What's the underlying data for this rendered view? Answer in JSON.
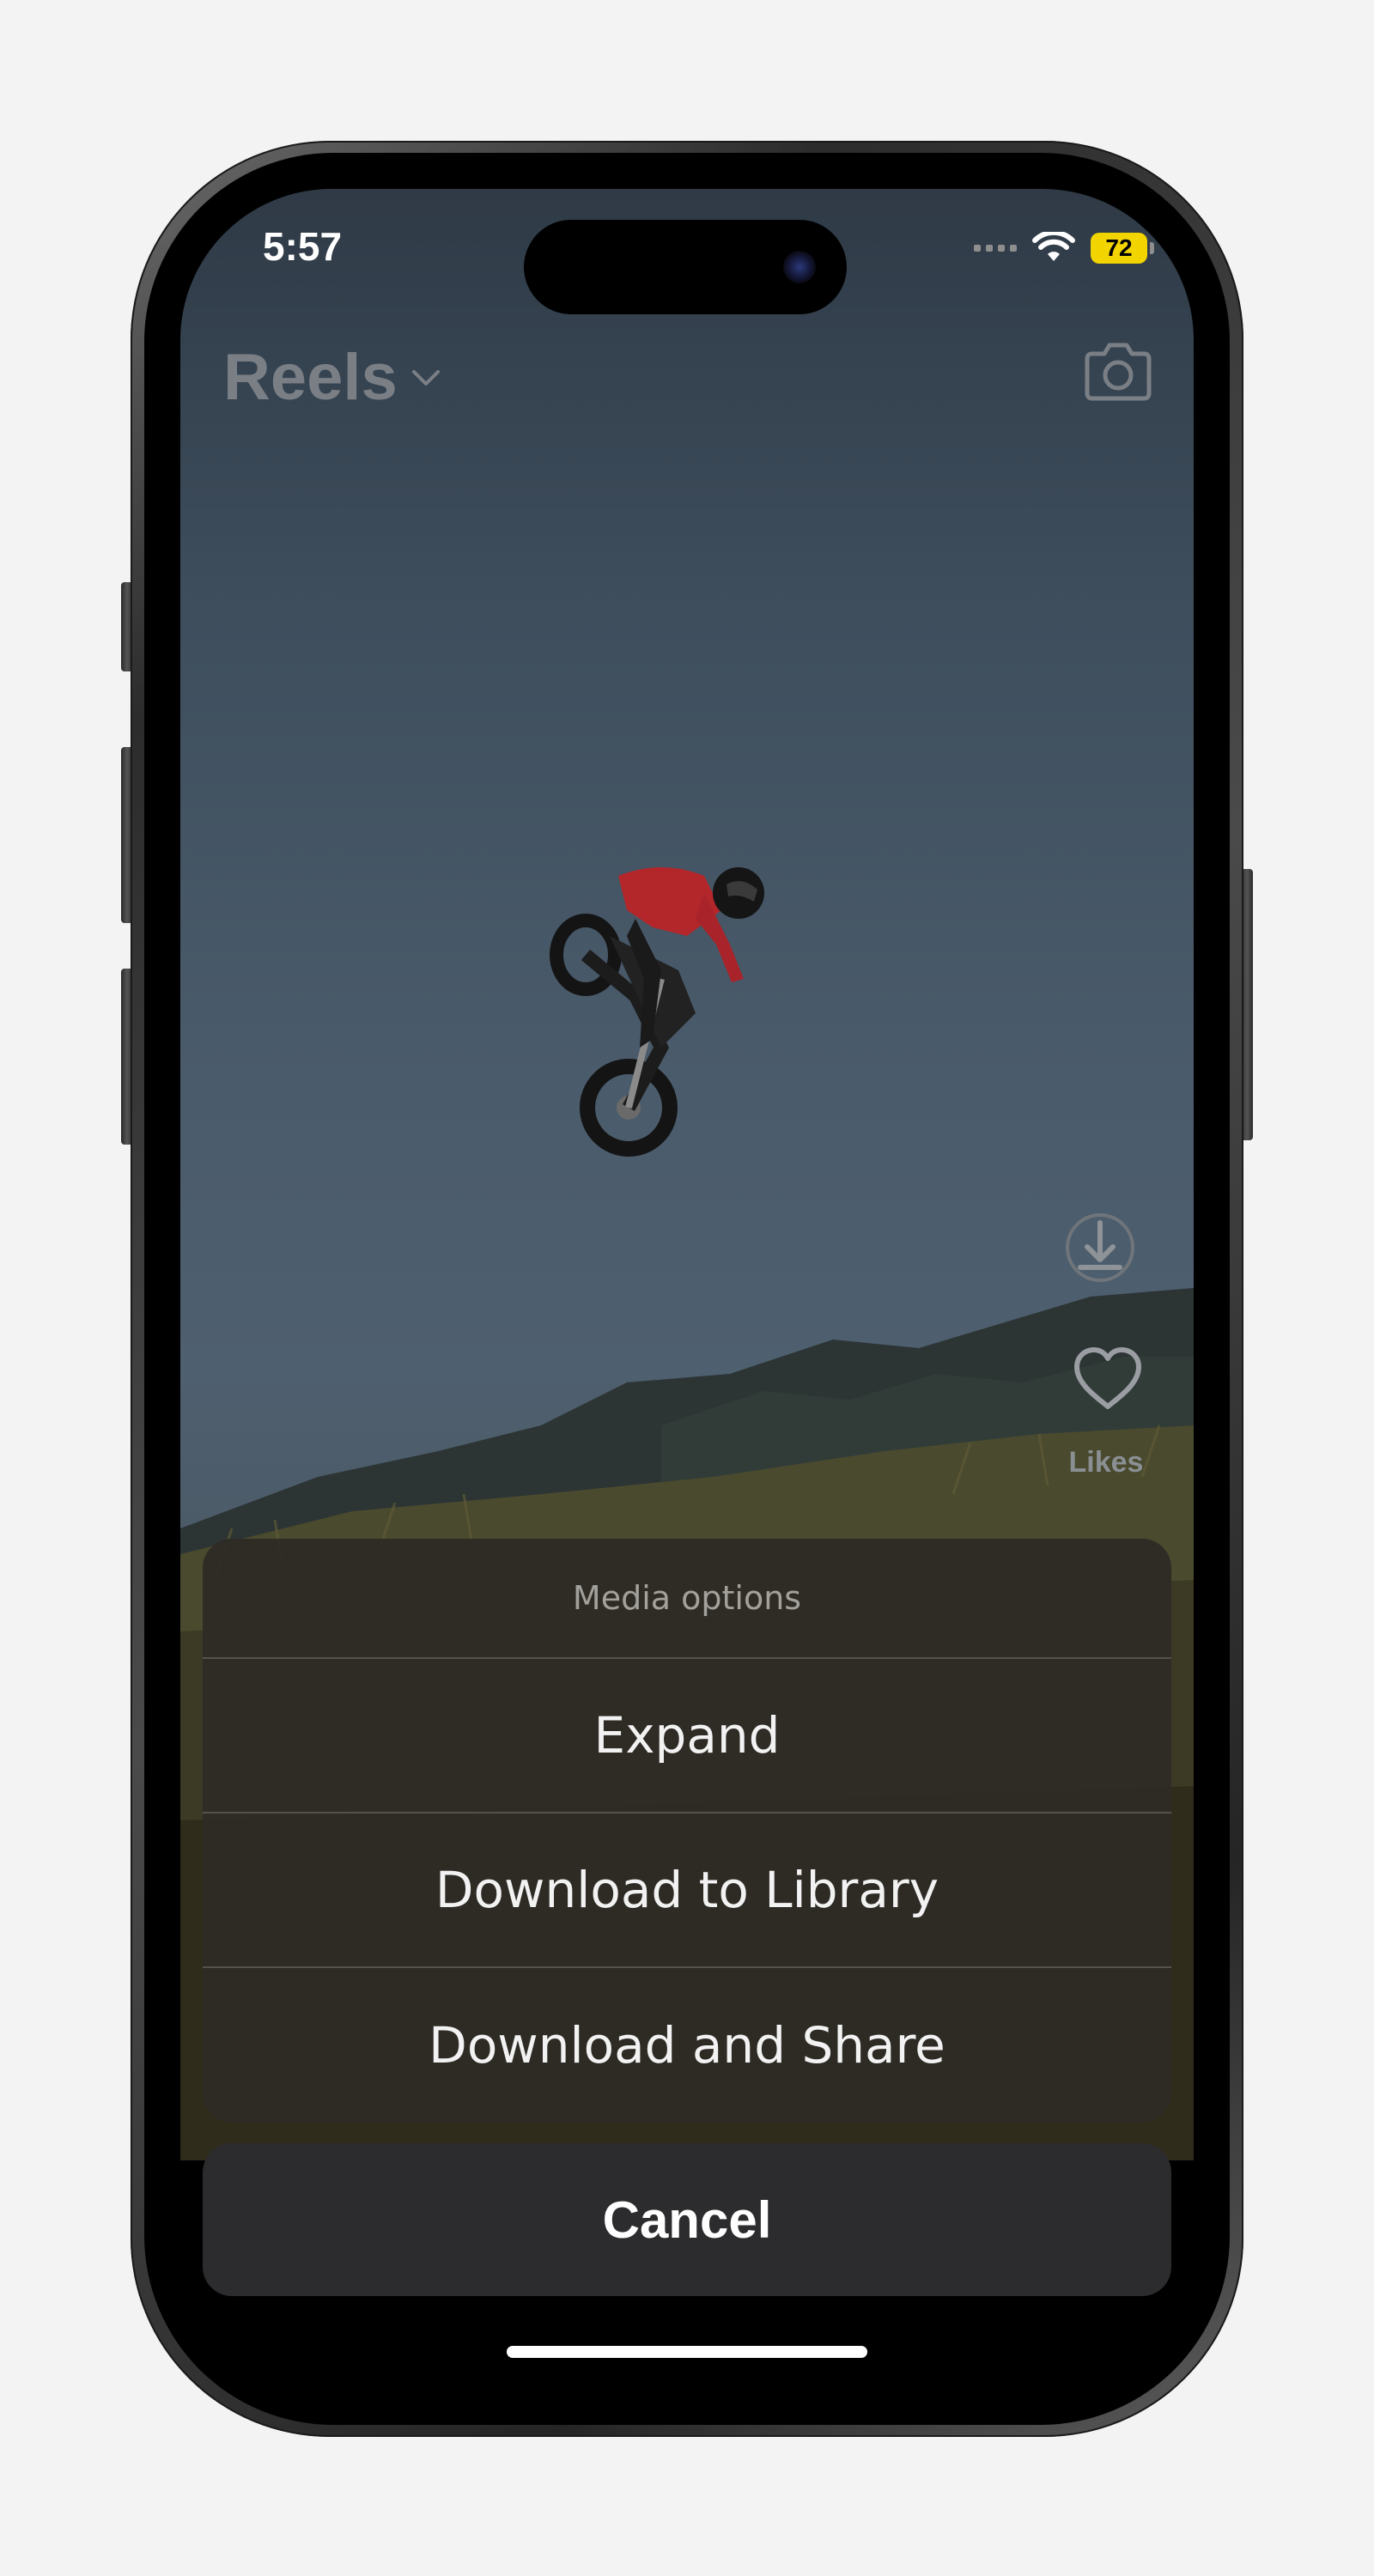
{
  "status_bar": {
    "time": "5:57",
    "battery": "72",
    "battery_color": "#f2d400"
  },
  "header": {
    "title": "Reels",
    "title_dropdown_icon": "chevron-down-icon",
    "camera_icon": "camera-icon"
  },
  "side_actions": {
    "download_icon": "download-icon",
    "like_icon": "heart-icon",
    "likes_label": "Likes"
  },
  "action_sheet": {
    "title": "Media options",
    "options": [
      {
        "label": "Expand"
      },
      {
        "label": "Download to Library"
      },
      {
        "label": "Download and Share"
      }
    ],
    "cancel_label": "Cancel"
  },
  "colors": {
    "sheet_background": "#2e2b26",
    "cancel_background": "#2c2c2e",
    "sky": "#4e5f6f"
  }
}
